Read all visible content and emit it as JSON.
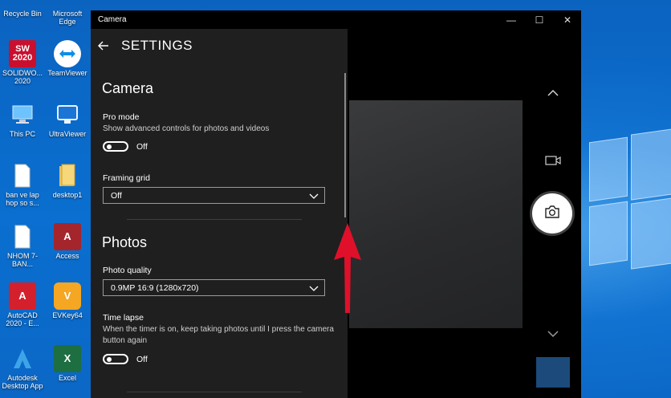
{
  "desktop": {
    "icons": [
      {
        "label": "Recycle Bin",
        "icon": "recycle-bin-icon"
      },
      {
        "label": "Microsoft Edge",
        "icon": "edge-icon"
      },
      {
        "label": "SOLIDWO... 2020",
        "icon": "solidworks-icon",
        "badge": "SW 2020"
      },
      {
        "label": "TeamViewer",
        "icon": "teamviewer-icon"
      },
      {
        "label": "This PC",
        "icon": "this-pc-icon"
      },
      {
        "label": "UltraViewer",
        "icon": "ultraviewer-icon"
      },
      {
        "label": "ban ve lap hop so s...",
        "icon": "document-icon"
      },
      {
        "label": "desktop1",
        "icon": "folder-icon"
      },
      {
        "label": "NHOM 7-BAN...",
        "icon": "document-icon"
      },
      {
        "label": "Access",
        "icon": "access-icon",
        "badge": "A"
      },
      {
        "label": "AutoCAD 2020 - E...",
        "icon": "autocad-icon",
        "badge": "A"
      },
      {
        "label": "EVKey64",
        "icon": "evkey-icon",
        "badge": "V"
      },
      {
        "label": "Autodesk Desktop App",
        "icon": "autodesk-icon",
        "badge": "A"
      },
      {
        "label": "Excel",
        "icon": "excel-icon",
        "badge": "X"
      }
    ]
  },
  "window": {
    "title": "Camera",
    "controls": {
      "minimize": "—",
      "maximize": "☐",
      "close": "✕"
    }
  },
  "settings": {
    "header": "SETTINGS",
    "camera_section": {
      "title": "Camera",
      "pro_mode": {
        "label": "Pro mode",
        "description": "Show advanced controls for photos and videos",
        "state": "Off"
      },
      "framing_grid": {
        "label": "Framing grid",
        "value": "Off"
      }
    },
    "photos_section": {
      "title": "Photos",
      "photo_quality": {
        "label": "Photo quality",
        "value": "0.9MP 16:9 (1280x720)"
      },
      "time_lapse": {
        "label": "Time lapse",
        "description": "When the timer is on, keep taking photos until I press the camera button again",
        "state": "Off"
      }
    }
  },
  "colors": {
    "settings_bg": "#1f1f1f",
    "window_bg": "#000000",
    "desktop_blue": "#0a6fd0",
    "annotation_red": "#e0102a"
  }
}
